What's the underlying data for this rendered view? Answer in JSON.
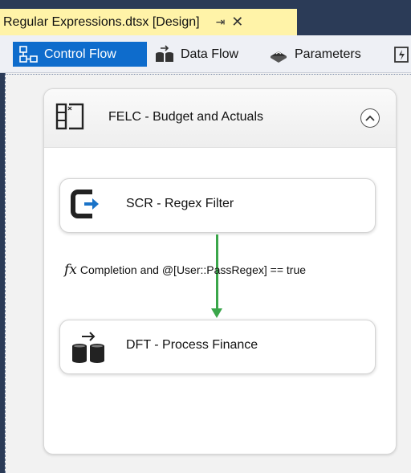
{
  "document_tab": {
    "title": "Regular Expressions.dtsx [Design]",
    "pin_icon": "⇥",
    "close_icon": "✕"
  },
  "toolbar": {
    "tabs": [
      {
        "label": "Control Flow",
        "icon": "control-flow-icon",
        "active": true
      },
      {
        "label": "Data Flow",
        "icon": "data-flow-icon",
        "active": false
      },
      {
        "label": "Parameters",
        "icon": "parameters-icon",
        "active": false
      }
    ],
    "accent": "#0e6ccc"
  },
  "container": {
    "title": "FELC - Budget and Actuals",
    "icon": "foreach-loop-icon",
    "collapse_icon": "chevron-up-icon"
  },
  "tasks": [
    {
      "label": "SCR - Regex Filter",
      "icon": "script-task-icon"
    },
    {
      "label": "DFT - Process Finance",
      "icon": "data-flow-task-icon"
    }
  ],
  "precedence_constraint": {
    "fx_symbol": "fx",
    "expression": "Completion and @[User::PassRegex] == true",
    "color": "#3aa64a"
  }
}
